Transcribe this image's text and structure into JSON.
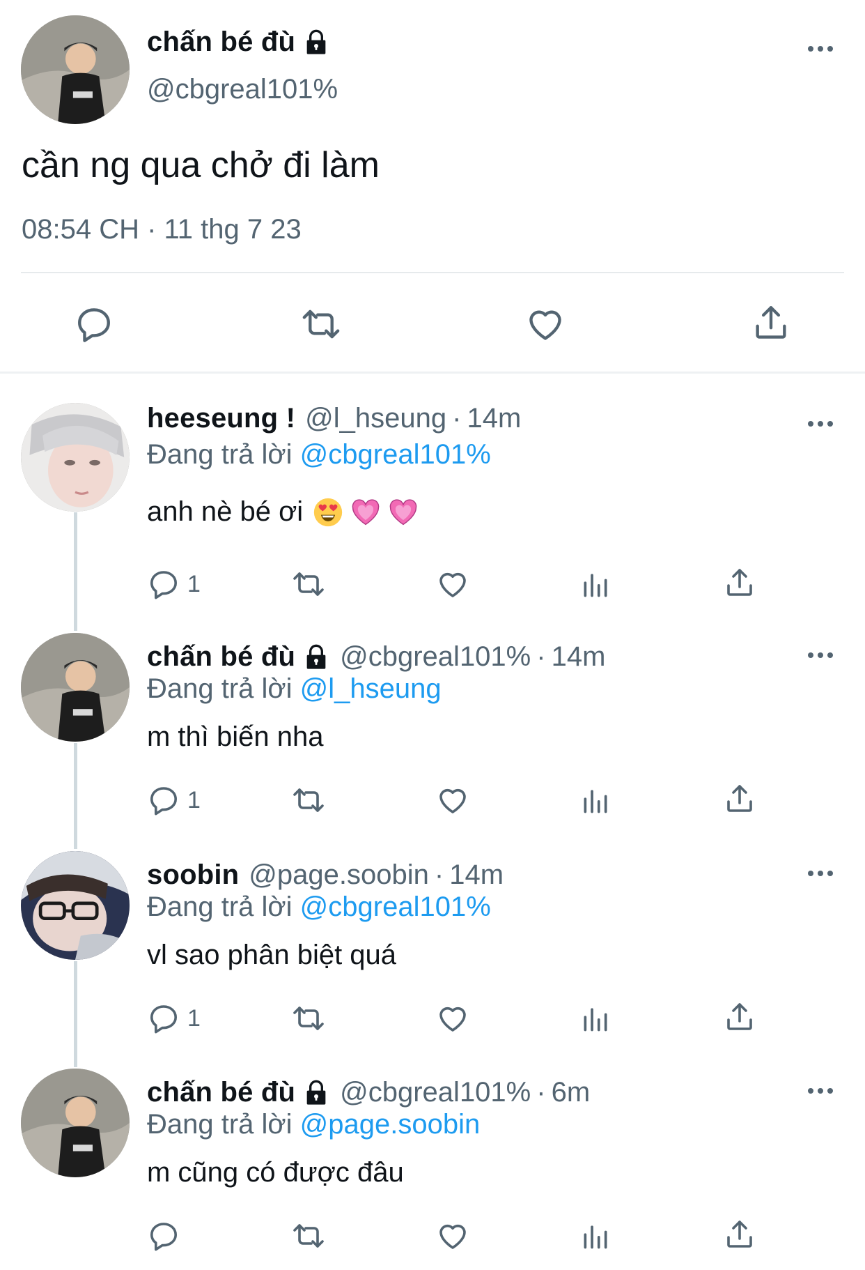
{
  "main_tweet": {
    "name": "chấn bé đù",
    "handle": "@cbgreal101%",
    "text": "cần ng qua chở đi làm",
    "meta": "08:54 CH · 11 thg 7 23",
    "icons": [
      "reply-icon",
      "retweet-icon",
      "like-icon",
      "share-icon",
      "lock-icon",
      "more-icon"
    ]
  },
  "replies": [
    {
      "name": "heeseung !",
      "handle": "@l_hseung",
      "dot": "·",
      "time": "14m",
      "replying_prefix": "Đang trả lời",
      "replying_to": "@cbgreal101%",
      "text": "anh nè bé ơi",
      "emojis": [
        "heart-eyes-emoji",
        "pink-heart-emoji",
        "pink-heart-emoji"
      ],
      "reply_count": "1"
    },
    {
      "name": "chấn bé đù",
      "handle": "@cbgreal101%",
      "dot": "·",
      "time": "14m",
      "replying_prefix": "Đang trả lời",
      "replying_to": "@l_hseung",
      "text": "m thì biến nha",
      "reply_count": "1"
    },
    {
      "name": "soobin",
      "handle": "@page.soobin",
      "dot": "·",
      "time": "14m",
      "replying_prefix": "Đang trả lời",
      "replying_to": "@cbgreal101%",
      "text": "vl sao phân biệt quá",
      "reply_count": "1"
    },
    {
      "name": "chấn bé đù",
      "handle": "@cbgreal101%",
      "dot": "·",
      "time": "6m",
      "replying_prefix": "Đang trả lời",
      "replying_to": "@page.soobin",
      "text": "m cũng có được đâu",
      "reply_count": ""
    }
  ],
  "colors": {
    "text": "#0f1419",
    "secondary": "#536471",
    "link": "#1d9bf0",
    "divider": "#e6eaec",
    "thread_line": "#cfd9de"
  }
}
